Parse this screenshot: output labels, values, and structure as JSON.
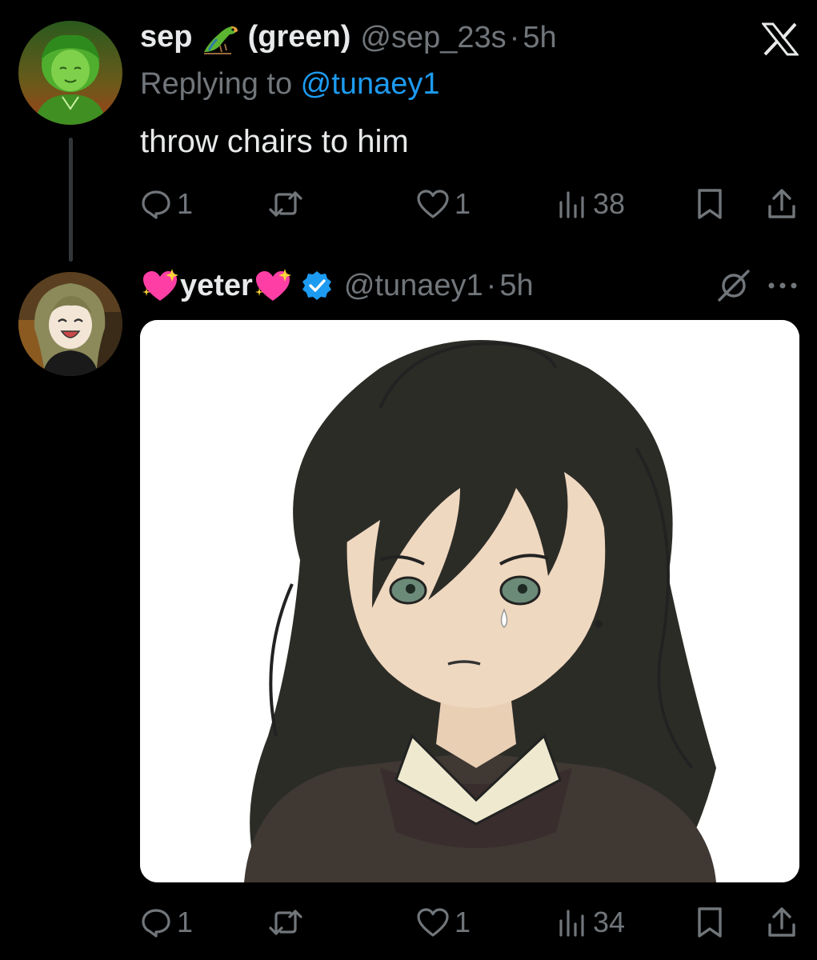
{
  "brand": {
    "name": "X",
    "accent": "#1d9bf0",
    "background": "#000000"
  },
  "tweets": [
    {
      "display_name_pre": "sep",
      "display_name_emoji": "parrot",
      "display_name_post": "(green)",
      "handle": "@sep_23s",
      "separator": "·",
      "time": "5h",
      "replying_prefix": "Replying to ",
      "replying_to": "@tunaey1",
      "text": "throw chairs to him",
      "stats": {
        "replies": "1",
        "likes": "1",
        "views": "38"
      }
    },
    {
      "display_name_emoji": "sparkling-heart",
      "display_name": "yeter",
      "verified": true,
      "handle": "@tunaey1",
      "separator": "·",
      "time": "5h",
      "media": "image",
      "stats": {
        "replies": "1",
        "likes": "1",
        "views": "34"
      }
    }
  ],
  "icons": [
    "x-logo-icon",
    "grok-icon",
    "more-icon",
    "reply-icon",
    "retweet-icon",
    "like-icon",
    "views-icon",
    "bookmark-icon",
    "share-icon",
    "verified-badge-icon"
  ]
}
